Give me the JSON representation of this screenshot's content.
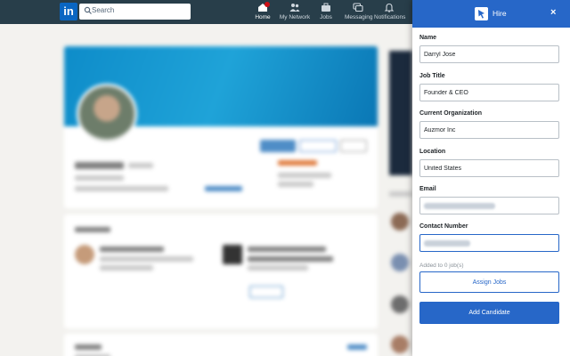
{
  "topbar": {
    "logo_text": "in",
    "search_placeholder": "Search",
    "nav": [
      {
        "label": "Home",
        "icon": "home-icon"
      },
      {
        "label": "My Network",
        "icon": "network-icon"
      },
      {
        "label": "Jobs",
        "icon": "briefcase-icon"
      },
      {
        "label": "Messaging",
        "icon": "messaging-icon"
      },
      {
        "label": "Notifications",
        "icon": "bell-icon"
      }
    ]
  },
  "panel": {
    "title": "Hire",
    "close_label": "×",
    "accent_color": "#2767c8",
    "fields": {
      "name": {
        "label": "Name",
        "value": "Darryl Jose"
      },
      "job_title": {
        "label": "Job Title",
        "value": "Founder & CEO"
      },
      "organization": {
        "label": "Current Organization",
        "value": "Auzmor Inc"
      },
      "location": {
        "label": "Location",
        "value": "United States"
      },
      "email": {
        "label": "Email",
        "value": ""
      },
      "contact": {
        "label": "Contact Number",
        "value": ""
      }
    },
    "jobs_note": "Added to 0 job(s)",
    "assign_button": "Assign Jobs",
    "add_button": "Add Candidate"
  }
}
